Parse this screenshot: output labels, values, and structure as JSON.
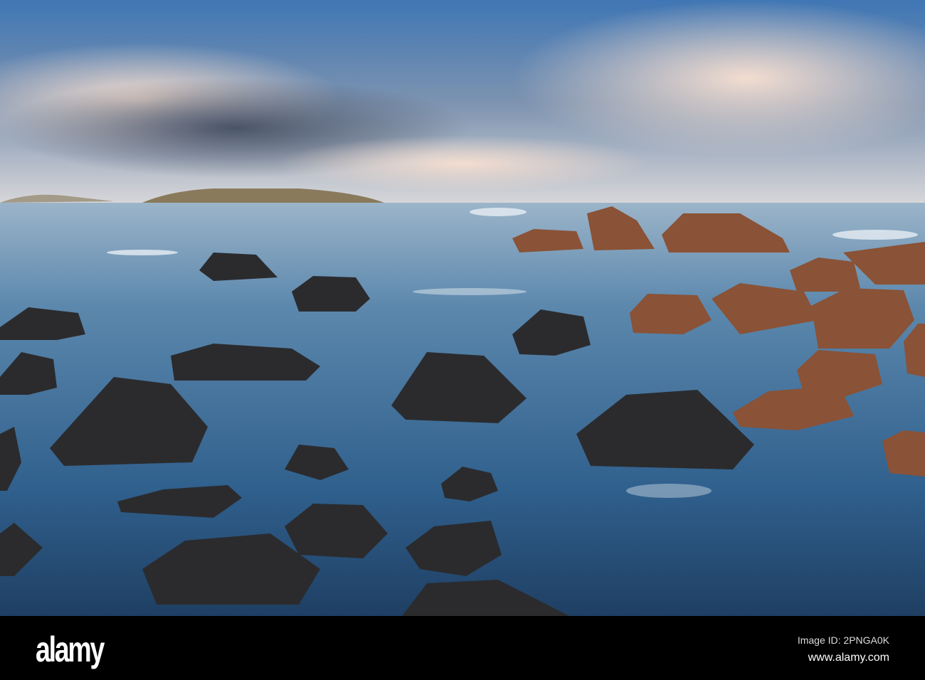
{
  "watermark": {
    "logo": "alamy",
    "image_id": "Image ID: 2PNGA0K",
    "url": "www.alamy.com"
  },
  "colors": {
    "sky_top": "#4a7fb8",
    "cloud": "#e9d3c4",
    "sea": "#3f6f98",
    "rock_dark": "#2a2a2c",
    "rock_lit": "#9a5a3a"
  }
}
